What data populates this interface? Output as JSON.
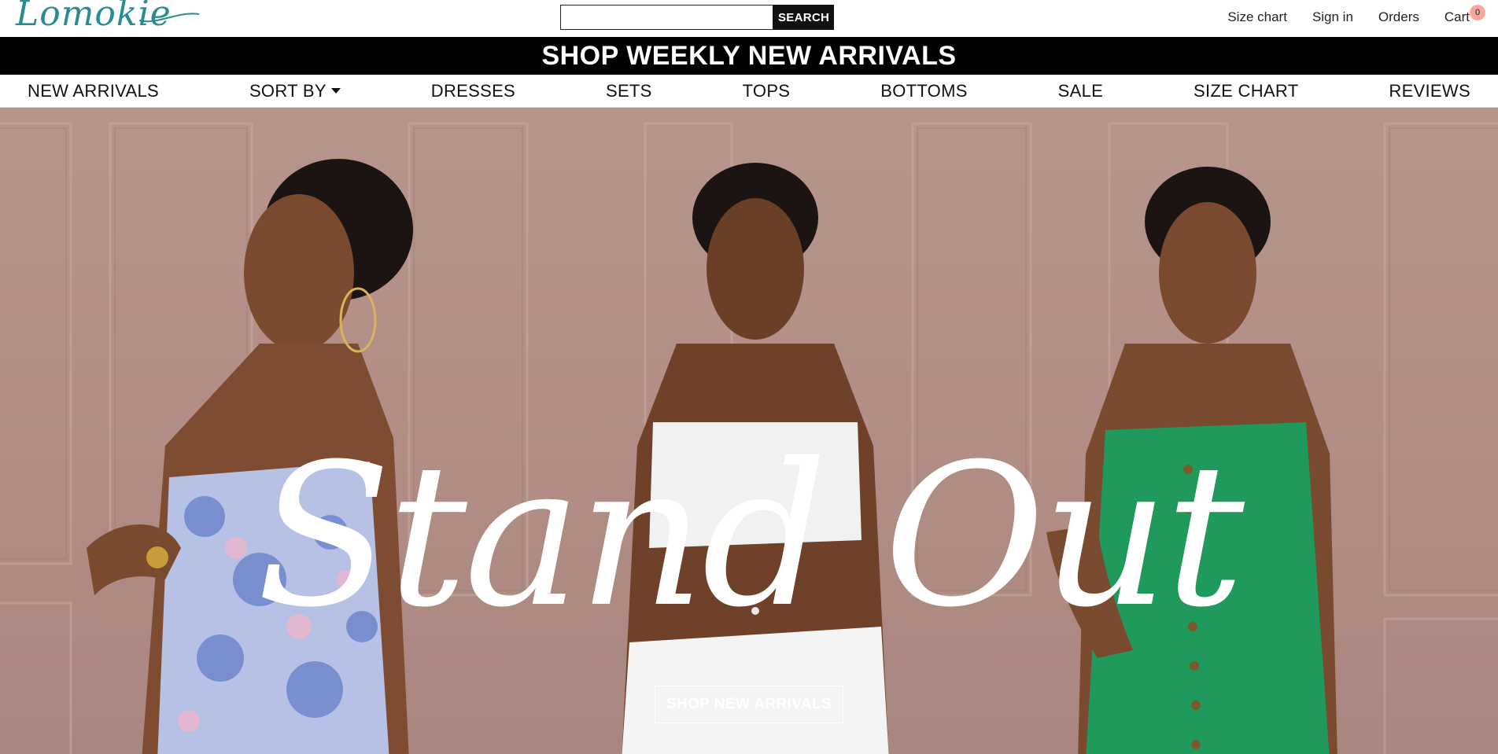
{
  "header": {
    "logo_text": "Lomokie",
    "search": {
      "placeholder": "",
      "button_label": "SEARCH"
    },
    "links": {
      "size_chart": "Size chart",
      "sign_in": "Sign in",
      "orders": "Orders",
      "cart": "Cart",
      "cart_count": "0"
    }
  },
  "promo": {
    "text": "SHOP WEEKLY NEW ARRIVALS"
  },
  "nav": {
    "items": [
      {
        "label": "NEW ARRIVALS"
      },
      {
        "label": "SORT BY"
      },
      {
        "label": "DRESSES"
      },
      {
        "label": "SETS"
      },
      {
        "label": "TOPS"
      },
      {
        "label": "BOTTOMS"
      },
      {
        "label": "SALE"
      },
      {
        "label": "SIZE CHART"
      },
      {
        "label": "REVIEWS"
      }
    ]
  },
  "hero": {
    "title": "Stand Out",
    "cta_label": "SHOP NEW ARRIVALS"
  },
  "colors": {
    "brand": "#2a8c8f",
    "banner_bg": "#000000",
    "hero_bg": "#b08c84",
    "cart_badge": "#f6a99a"
  }
}
